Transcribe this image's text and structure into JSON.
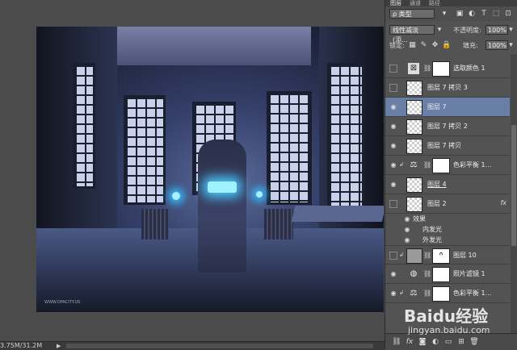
{
  "panel": {
    "tabs": [
      "图层",
      "通道",
      "路径"
    ],
    "filter_kind": "ρ 类型",
    "blend_mode": "线性减淡 (添...",
    "opacity_label": "不透明度:",
    "opacity_value": "100%",
    "lock_label": "锁定:",
    "fill_label": "填充:",
    "fill_value": "100%",
    "layers": [
      {
        "name": "选取颜色 1",
        "type": "adjustment",
        "icon": "selective-color-icon",
        "visible": false
      },
      {
        "name": "图层 7 拷贝 3",
        "type": "pixel",
        "visible": false
      },
      {
        "name": "图层 7",
        "type": "pixel",
        "visible": true,
        "selected": true
      },
      {
        "name": "图层 7 拷贝 2",
        "type": "pixel",
        "visible": true
      },
      {
        "name": "图层 7 拷贝",
        "type": "pixel",
        "visible": true
      },
      {
        "name": "色彩平衡 1...",
        "type": "adjustment",
        "icon": "color-balance-icon",
        "visible": true,
        "clipped": true
      },
      {
        "name": "图层 4",
        "type": "pixel",
        "visible": true,
        "underline": true
      },
      {
        "name": "图层 2",
        "type": "pixel",
        "visible": false,
        "fx": "fx"
      },
      {
        "name": "图层 10",
        "type": "curves-masked",
        "visible": false,
        "clipped": true
      },
      {
        "name": "照片滤镜 1",
        "type": "adjustment",
        "icon": "photo-filter-icon",
        "visible": true
      },
      {
        "name": "色彩平衡 1...",
        "type": "adjustment",
        "icon": "color-balance-icon",
        "visible": true,
        "clipped": true
      }
    ],
    "effects": {
      "header": "效果",
      "items": [
        "内发光",
        "外发光"
      ]
    }
  },
  "status": {
    "doc_size": "3.75M/31.2M"
  },
  "canvas": {
    "credit": "WWW.OPACITY.US"
  },
  "watermark": {
    "brand": "Baidu经验",
    "url": "jingyan.baidu.com"
  }
}
